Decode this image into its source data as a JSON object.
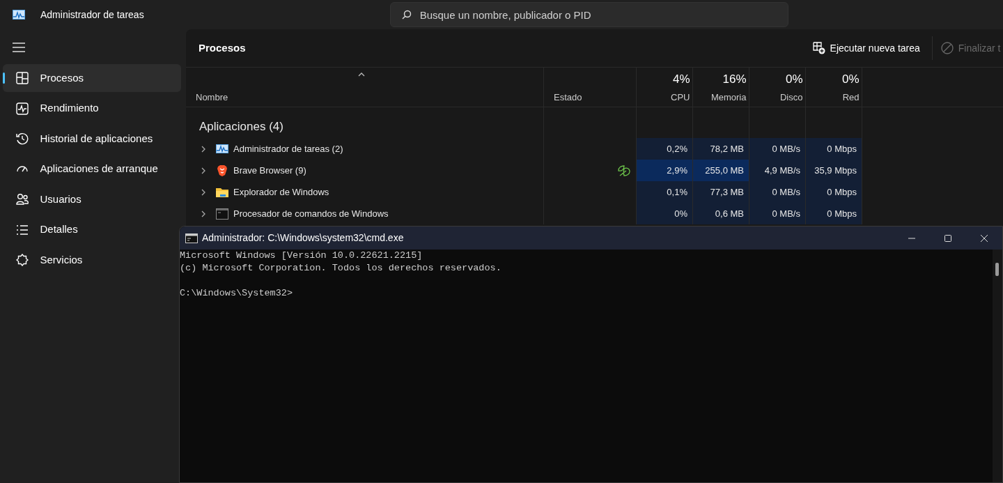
{
  "window": {
    "title": "Administrador de tareas"
  },
  "search": {
    "placeholder": "Busque un nombre, publicador o PID"
  },
  "sidebar": {
    "items": [
      {
        "label": "Procesos",
        "selected": true
      },
      {
        "label": "Rendimiento",
        "selected": false
      },
      {
        "label": "Historial de aplicaciones",
        "selected": false
      },
      {
        "label": "Aplicaciones de arranque",
        "selected": false
      },
      {
        "label": "Usuarios",
        "selected": false
      },
      {
        "label": "Detalles",
        "selected": false
      },
      {
        "label": "Servicios",
        "selected": false
      }
    ]
  },
  "page": {
    "title": "Procesos",
    "actions": [
      {
        "label": "Ejecutar nueva tarea",
        "disabled": false
      },
      {
        "label": "Finalizar t",
        "disabled": true
      }
    ]
  },
  "table": {
    "columns": [
      {
        "label": "Nombre",
        "sort_ascending": true
      },
      {
        "label": "Estado"
      },
      {
        "label": "CPU",
        "total": "4%"
      },
      {
        "label": "Memoria",
        "total": "16%"
      },
      {
        "label": "Disco",
        "total": "0%"
      },
      {
        "label": "Red",
        "total": "0%"
      }
    ],
    "group": "Aplicaciones (4)",
    "rows": [
      {
        "name": "Administrador de tareas (2)",
        "efficiency_mode": false,
        "values": [
          {
            "text": "0,2%",
            "high": false
          },
          {
            "text": "78,2 MB",
            "high": false
          },
          {
            "text": "0 MB/s",
            "high": false
          },
          {
            "text": "0 Mbps",
            "high": false
          }
        ]
      },
      {
        "name": "Brave Browser (9)",
        "efficiency_mode": true,
        "values": [
          {
            "text": "2,9%",
            "high": true
          },
          {
            "text": "255,0 MB",
            "high": true
          },
          {
            "text": "4,9 MB/s",
            "high": false
          },
          {
            "text": "35,9 Mbps",
            "high": false
          }
        ]
      },
      {
        "name": "Explorador de Windows",
        "efficiency_mode": false,
        "values": [
          {
            "text": "0,1%",
            "high": false
          },
          {
            "text": "77,3 MB",
            "high": false
          },
          {
            "text": "0 MB/s",
            "high": false
          },
          {
            "text": "0 Mbps",
            "high": false
          }
        ]
      },
      {
        "name": "Procesador de comandos de Windows",
        "efficiency_mode": false,
        "values": [
          {
            "text": "0%",
            "high": false
          },
          {
            "text": "0,6 MB",
            "high": false
          },
          {
            "text": "0 MB/s",
            "high": false
          },
          {
            "text": "0 Mbps",
            "high": false
          }
        ]
      }
    ]
  },
  "console": {
    "title": "Administrador: C:\\Windows\\system32\\cmd.exe",
    "banner": [
      "Microsoft Windows [Versión 10.0.22621.2215]",
      "(c) Microsoft Corporation. Todos los derechos reservados."
    ],
    "prompt": "C:\\Windows\\System32>"
  }
}
